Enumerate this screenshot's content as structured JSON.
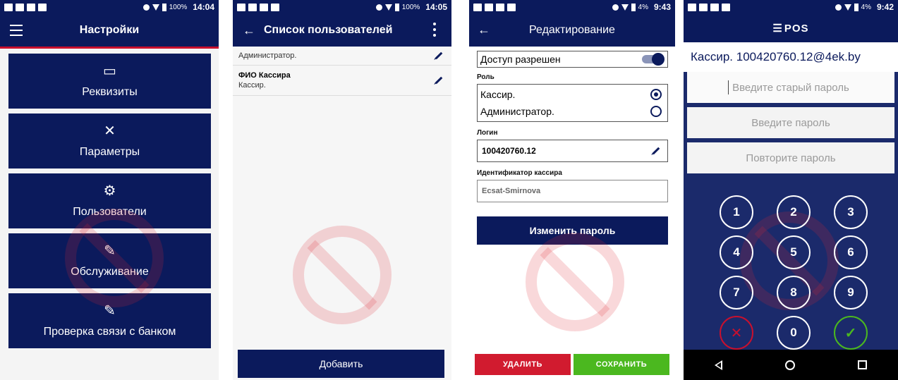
{
  "colors": {
    "primary": "#0b1a5c",
    "accent_red": "#c8102e",
    "delete": "#d11b2f",
    "save": "#4bb81f"
  },
  "screen1": {
    "status": {
      "battery": "100%",
      "time": "14:04"
    },
    "title": "Настройки",
    "tiles": [
      {
        "label": "Реквизиты",
        "icon": "monitor-settings-icon"
      },
      {
        "label": "Параметры",
        "icon": "tools-icon"
      },
      {
        "label": "Пользователи",
        "icon": "users-gear-icon"
      },
      {
        "label": "Обслуживание",
        "icon": "wrench-icon"
      },
      {
        "label": "Проверка связи с банком",
        "icon": "wrench-icon"
      }
    ]
  },
  "screen2": {
    "status": {
      "battery": "100%",
      "time": "14:05"
    },
    "title": "Список пользователей",
    "users": [
      {
        "role": "Администратор.",
        "name": ""
      },
      {
        "name": "ФИО Кассира",
        "role": "Кассир."
      }
    ],
    "add_label": "Добавить"
  },
  "screen3": {
    "status": {
      "battery": "4%",
      "time": "9:43"
    },
    "title": "Редактирование",
    "access_label": "Доступ разрешен",
    "access_enabled": true,
    "role_label": "Роль",
    "roles": [
      {
        "label": "Кассир.",
        "selected": true
      },
      {
        "label": "Администратор.",
        "selected": false
      }
    ],
    "login_label": "Логин",
    "login_value": "100420760.12",
    "cashier_id_label": "Идентификатор кассира",
    "cashier_id_value": "Ecsat-Smirnova",
    "change_password_label": "Изменить пароль",
    "delete_label": "УДАЛИТЬ",
    "save_label": "СОХРАНИТЬ"
  },
  "screen4": {
    "status": {
      "battery": "4%",
      "time": "9:42"
    },
    "logo": "POS",
    "cashier_line": "Кассир. 100420760.12@4ek.by",
    "old_password_placeholder": "Введите старый пароль",
    "password_placeholder": "Введите пароль",
    "repeat_password_placeholder": "Повторите пароль",
    "keys": [
      "1",
      "2",
      "3",
      "4",
      "5",
      "6",
      "7",
      "8",
      "9",
      "✕",
      "0",
      "✓"
    ]
  }
}
